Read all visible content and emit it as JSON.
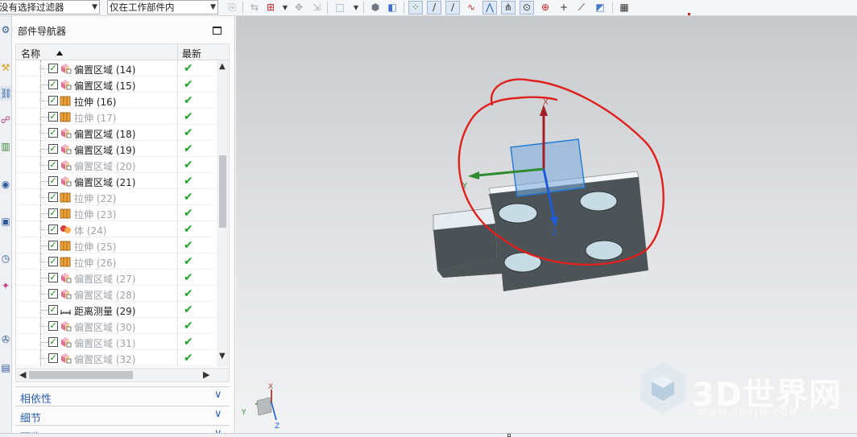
{
  "toolbar": {
    "selection_filter": "没有选择过滤器",
    "scope_filter": "仅在工作部件内",
    "icons": [
      "deselect-icon",
      "snap-icon",
      "point-dialog-icon",
      "move-icon",
      "select-box-icon",
      "shaded-icon",
      "view-icon",
      "endpoint-snap-icon",
      "line-icon",
      "curve-icon",
      "spline-icon",
      "polyline-icon",
      "intersection-icon",
      "center-icon",
      "quadrant-icon",
      "point-icon",
      "tangent-icon",
      "view-section-icon",
      "grid-icon"
    ]
  },
  "resource_bar": {
    "icons": [
      "settings-icon",
      "assembly-navigator-icon",
      "constraint-navigator-icon",
      "part-navigator-icon",
      "reuse-library-icon",
      "web-browser-icon",
      "history-icon",
      "system-materials-icon",
      "process-studio-icon",
      "roles-icon"
    ]
  },
  "navigator": {
    "title": "部件导航器",
    "columns": {
      "name": "名称",
      "latest": "最新"
    },
    "rows": [
      {
        "label": "偏置区域 (14)",
        "icon": "offset-region-icon",
        "dim": false
      },
      {
        "label": "偏置区域 (15)",
        "icon": "offset-region-icon",
        "dim": false
      },
      {
        "label": "拉伸 (16)",
        "icon": "extrude-icon",
        "dim": false
      },
      {
        "label": "拉伸 (17)",
        "icon": "extrude-icon",
        "dim": true
      },
      {
        "label": "偏置区域 (18)",
        "icon": "offset-region-icon",
        "dim": false
      },
      {
        "label": "偏置区域 (19)",
        "icon": "offset-region-icon",
        "dim": false
      },
      {
        "label": "偏置区域 (20)",
        "icon": "offset-region-icon",
        "dim": true
      },
      {
        "label": "偏置区域 (21)",
        "icon": "offset-region-icon",
        "dim": false
      },
      {
        "label": "拉伸 (22)",
        "icon": "extrude-icon",
        "dim": true
      },
      {
        "label": "拉伸 (23)",
        "icon": "extrude-icon",
        "dim": true
      },
      {
        "label": "体 (24)",
        "icon": "body-icon",
        "dim": true
      },
      {
        "label": "拉伸 (25)",
        "icon": "extrude-icon",
        "dim": true
      },
      {
        "label": "拉伸 (26)",
        "icon": "extrude-icon",
        "dim": true
      },
      {
        "label": "偏置区域 (27)",
        "icon": "offset-region-icon",
        "dim": true
      },
      {
        "label": "偏置区域 (28)",
        "icon": "offset-region-icon",
        "dim": true
      },
      {
        "label": "距离测量 (29)",
        "icon": "distance-measure-icon",
        "dim": false
      },
      {
        "label": "偏置区域 (30)",
        "icon": "offset-region-icon",
        "dim": true
      },
      {
        "label": "偏置区域 (31)",
        "icon": "offset-region-icon",
        "dim": true
      },
      {
        "label": "偏置区域 (32)",
        "icon": "offset-region-icon",
        "dim": true
      }
    ],
    "sections": [
      "相依性",
      "细节",
      "预览"
    ]
  },
  "viewport": {
    "axis_labels": {
      "x": "X",
      "y": "Y",
      "z": "Z"
    },
    "triad_labels": {
      "x": "X",
      "y": "Y",
      "z": "Z"
    },
    "watermark_text": "3D世界网",
    "watermark_url": "WWW.3DSJW.COM"
  },
  "colors": {
    "x_axis": "#a31f24",
    "y_axis": "#2e8b2e",
    "z_axis": "#1f5bd6",
    "annotation": "#e0201e",
    "part_face": "#4d5457",
    "check": "#22a52a"
  }
}
